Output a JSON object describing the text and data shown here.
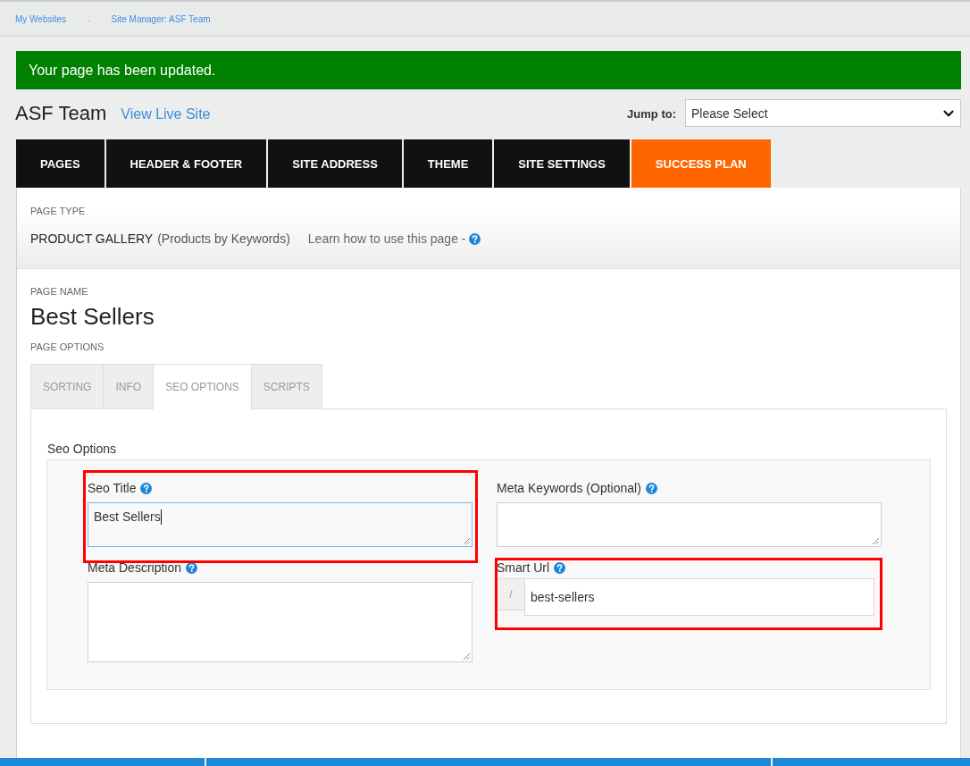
{
  "breadcrumb": {
    "items": [
      {
        "label": "My Websites"
      },
      {
        "label": "Site Manager: ASF Team"
      }
    ],
    "separator": "."
  },
  "alert": {
    "kind": "success",
    "message": "Your page has been updated."
  },
  "header": {
    "site_name": "ASF Team",
    "live_link": "View Live Site",
    "jump_to": {
      "label": "Jump to:",
      "value": "Please Select"
    }
  },
  "nav_tabs": [
    {
      "label": "PAGES",
      "color": "#111111"
    },
    {
      "label": "HEADER & FOOTER",
      "color": "#111111"
    },
    {
      "label": "SITE ADDRESS",
      "color": "#111111"
    },
    {
      "label": "THEME",
      "color": "#111111"
    },
    {
      "label": "SITE SETTINGS",
      "color": "#111111"
    },
    {
      "label": "SUCCESS PLAN",
      "color": "#ff6600"
    }
  ],
  "page_type": {
    "heading": "PAGE TYPE",
    "type": "PRODUCT GALLERY",
    "detail": "(Products by Keywords)",
    "help_link": "Learn how to use this page -"
  },
  "page_name": {
    "heading": "PAGE NAME",
    "value": "Best Sellers"
  },
  "page_options": {
    "heading": "PAGE OPTIONS",
    "tabs": [
      {
        "label": "SORTING",
        "selected": false
      },
      {
        "label": "INFO",
        "selected": false
      },
      {
        "label": "SEO OPTIONS",
        "selected": true
      },
      {
        "label": "SCRIPTS",
        "selected": false
      }
    ],
    "section_title": "Seo Options",
    "fields": [
      {
        "kind": "textarea",
        "label": "Seo Title",
        "value": "Best Sellers",
        "focused": true,
        "highlighted": true
      },
      {
        "kind": "textarea",
        "label": "Meta Keywords (Optional)",
        "focused": false,
        "highlighted": false
      },
      {
        "kind": "tall_textarea",
        "label": "Meta Description",
        "focused": false,
        "highlighted": false
      },
      {
        "kind": "url",
        "label": "Smart Url",
        "prefix": "/",
        "value": "best-sellers",
        "focused": false,
        "highlighted": true
      }
    ]
  }
}
